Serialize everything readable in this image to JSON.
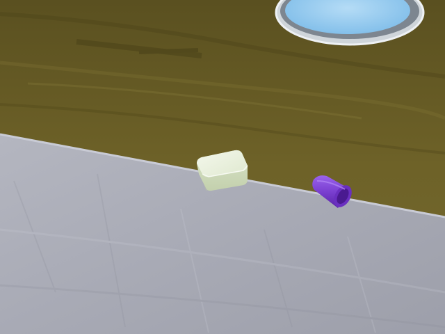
{
  "scene": {
    "objects": [
      {
        "name": "white-block",
        "color": "#e6eed8"
      },
      {
        "name": "purple-cup",
        "color": "#7a3fd0"
      }
    ],
    "colors": {
      "floor": "#6b5f26",
      "floor_dark": "#4f4619",
      "table": "#a9abb6",
      "table_light": "#c2c4cf",
      "sink_water": "#8fc8f0",
      "sink_rim": "#d8dde2"
    }
  }
}
